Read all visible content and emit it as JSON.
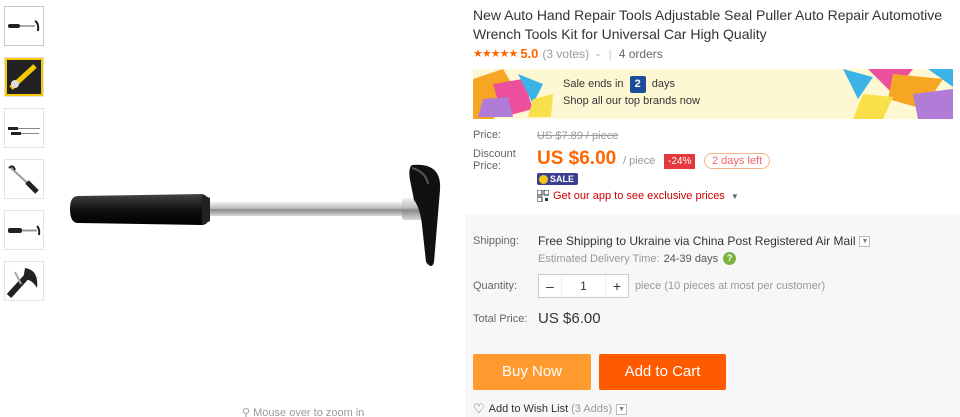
{
  "product": {
    "title": "New Auto Hand Repair Tools Adjustable Seal Puller Auto Repair Automotive Wrench Tools Kit for Universal Car High Quality",
    "rating": "5.0",
    "votes": "(3 votes)",
    "orders": "4 orders"
  },
  "gallery": {
    "thumbnail_count": 6,
    "zoom_hint": "Mouse over to zoom in"
  },
  "banner": {
    "sale_ends_prefix": "Sale ends in",
    "days_count": "2",
    "days_label": "days",
    "subtitle": "Shop all our top brands now"
  },
  "price": {
    "price_label": "Price:",
    "original": "US $7.89 / piece",
    "discount_label_1": "Discount",
    "discount_label_2": "Price:",
    "current": "US $6.00",
    "unit": "/ piece",
    "off_badge": "-24%",
    "days_left": "2 days left",
    "sale_badge": "SALE",
    "app_link": "Get our app to see exclusive prices"
  },
  "shipping": {
    "label": "Shipping:",
    "free": "Free Shipping to Ukraine via China Post Registered Air Mail",
    "delivery_label": "Estimated Delivery Time:",
    "delivery_value": "24-39 days"
  },
  "quantity": {
    "label": "Quantity:",
    "value": "1",
    "minus": "–",
    "plus": "+",
    "note": "piece (10 pieces at most per customer)"
  },
  "total": {
    "label": "Total Price:",
    "value": "US $6.00"
  },
  "actions": {
    "buy_now": "Buy Now",
    "add_to_cart": "Add to Cart",
    "wishlist": "Add to Wish List",
    "wishlist_count": "(3 Adds)"
  },
  "colors": {
    "accent_orange": "#ff6600",
    "buy_now": "#ff9a2e",
    "add_to_cart": "#ff5a00",
    "discount_red": "#e4393c",
    "sale_navy": "#1d4c98"
  }
}
